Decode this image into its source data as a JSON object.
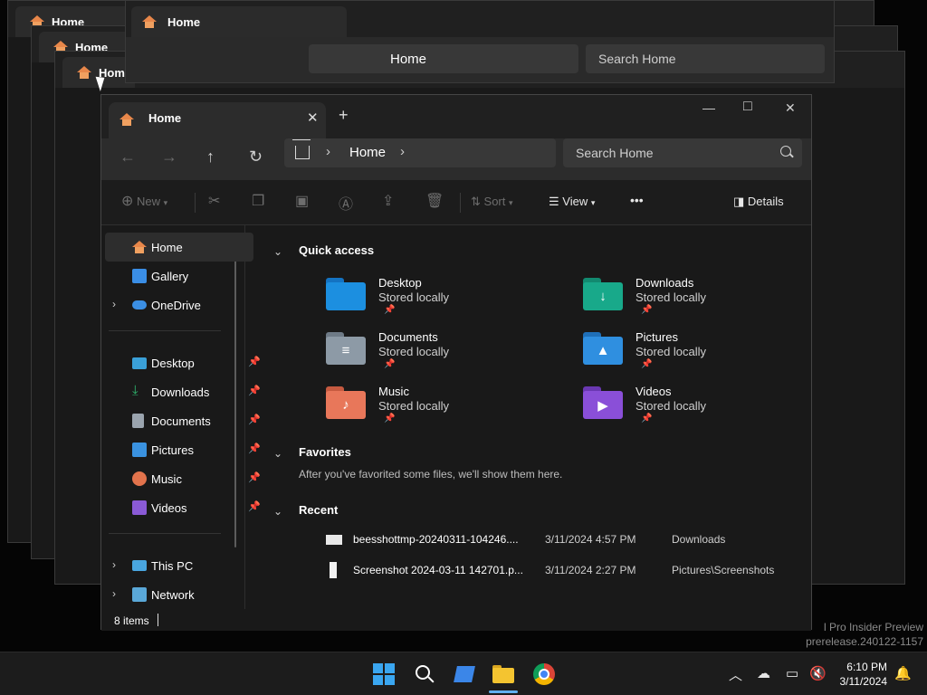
{
  "window": {
    "tab_title": "Home",
    "controls": {
      "minimize": "—",
      "maximize": "□",
      "close": "✕",
      "tab_close": "✕",
      "new_tab": "+"
    }
  },
  "nav": {
    "back": "←",
    "forward": "→",
    "up": "↑",
    "refresh": "↻",
    "breadcrumb": "Home",
    "search_placeholder": "Search Home"
  },
  "toolbar": {
    "new_label": "New",
    "sort_label": "Sort",
    "view_label": "View",
    "more_label": "•••",
    "details_label": "Details"
  },
  "sidebar": {
    "items": [
      {
        "label": "Home",
        "icon": "home-icon",
        "color": "#e8874a",
        "selected": true
      },
      {
        "label": "Gallery",
        "icon": "gallery-icon",
        "color": "#3a8ee6"
      },
      {
        "label": "OneDrive",
        "icon": "onedrive-icon",
        "color": "#3b8fe4",
        "expandable": true
      },
      {
        "label": "Desktop",
        "icon": "desktop-icon",
        "color": "#3aa0d8",
        "pinned": true
      },
      {
        "label": "Downloads",
        "icon": "downloads-icon",
        "color": "#2fb36d",
        "pinned": true
      },
      {
        "label": "Documents",
        "icon": "documents-icon",
        "color": "#9aa4ae",
        "pinned": true
      },
      {
        "label": "Pictures",
        "icon": "pictures-icon",
        "color": "#3a92e0",
        "pinned": true
      },
      {
        "label": "Music",
        "icon": "music-icon",
        "color": "#e2734c",
        "pinned": true
      },
      {
        "label": "Videos",
        "icon": "videos-icon",
        "color": "#8a5ad6",
        "pinned": true
      },
      {
        "label": "This PC",
        "icon": "this-pc-icon",
        "color": "#49a6e0",
        "expandable": true
      },
      {
        "label": "Network",
        "icon": "network-icon",
        "color": "#5aa8d8",
        "expandable": true
      }
    ]
  },
  "sections": {
    "quick_access": "Quick access",
    "favorites": "Favorites",
    "favorites_note": "After you've favorited some files, we'll show them here.",
    "recent": "Recent"
  },
  "quick_access": [
    {
      "name": "Desktop",
      "status": "Stored locally",
      "icon": "desktop-folder-icon",
      "color": "#1c8fe0",
      "glyph": ""
    },
    {
      "name": "Downloads",
      "status": "Stored locally",
      "icon": "downloads-folder-icon",
      "color": "#18a98a",
      "glyph": "↓"
    },
    {
      "name": "Documents",
      "status": "Stored locally",
      "icon": "documents-folder-icon",
      "color": "#8d9aa6",
      "glyph": "≡"
    },
    {
      "name": "Pictures",
      "status": "Stored locally",
      "icon": "pictures-folder-icon",
      "color": "#2f8fe0",
      "glyph": "▲"
    },
    {
      "name": "Music",
      "status": "Stored locally",
      "icon": "music-folder-icon",
      "color": "#e8775a",
      "glyph": "♪"
    },
    {
      "name": "Videos",
      "status": "Stored locally",
      "icon": "videos-folder-icon",
      "color": "#8a4fd8",
      "glyph": "▶"
    }
  ],
  "recent": [
    {
      "file": "beesshottmp-20240311-104246....",
      "date": "3/11/2024 4:57 PM",
      "location": "Downloads"
    },
    {
      "file": "Screenshot 2024-03-11 142701.p...",
      "date": "3/11/2024 2:27 PM",
      "location": "Pictures\\Screenshots"
    }
  ],
  "status": {
    "items": "8 items"
  },
  "watermark": {
    "line1": "l Pro Insider Preview",
    "line2": "prerelease.240122-1157"
  },
  "clock": {
    "time": "6:10 PM",
    "date": "3/11/2024"
  }
}
